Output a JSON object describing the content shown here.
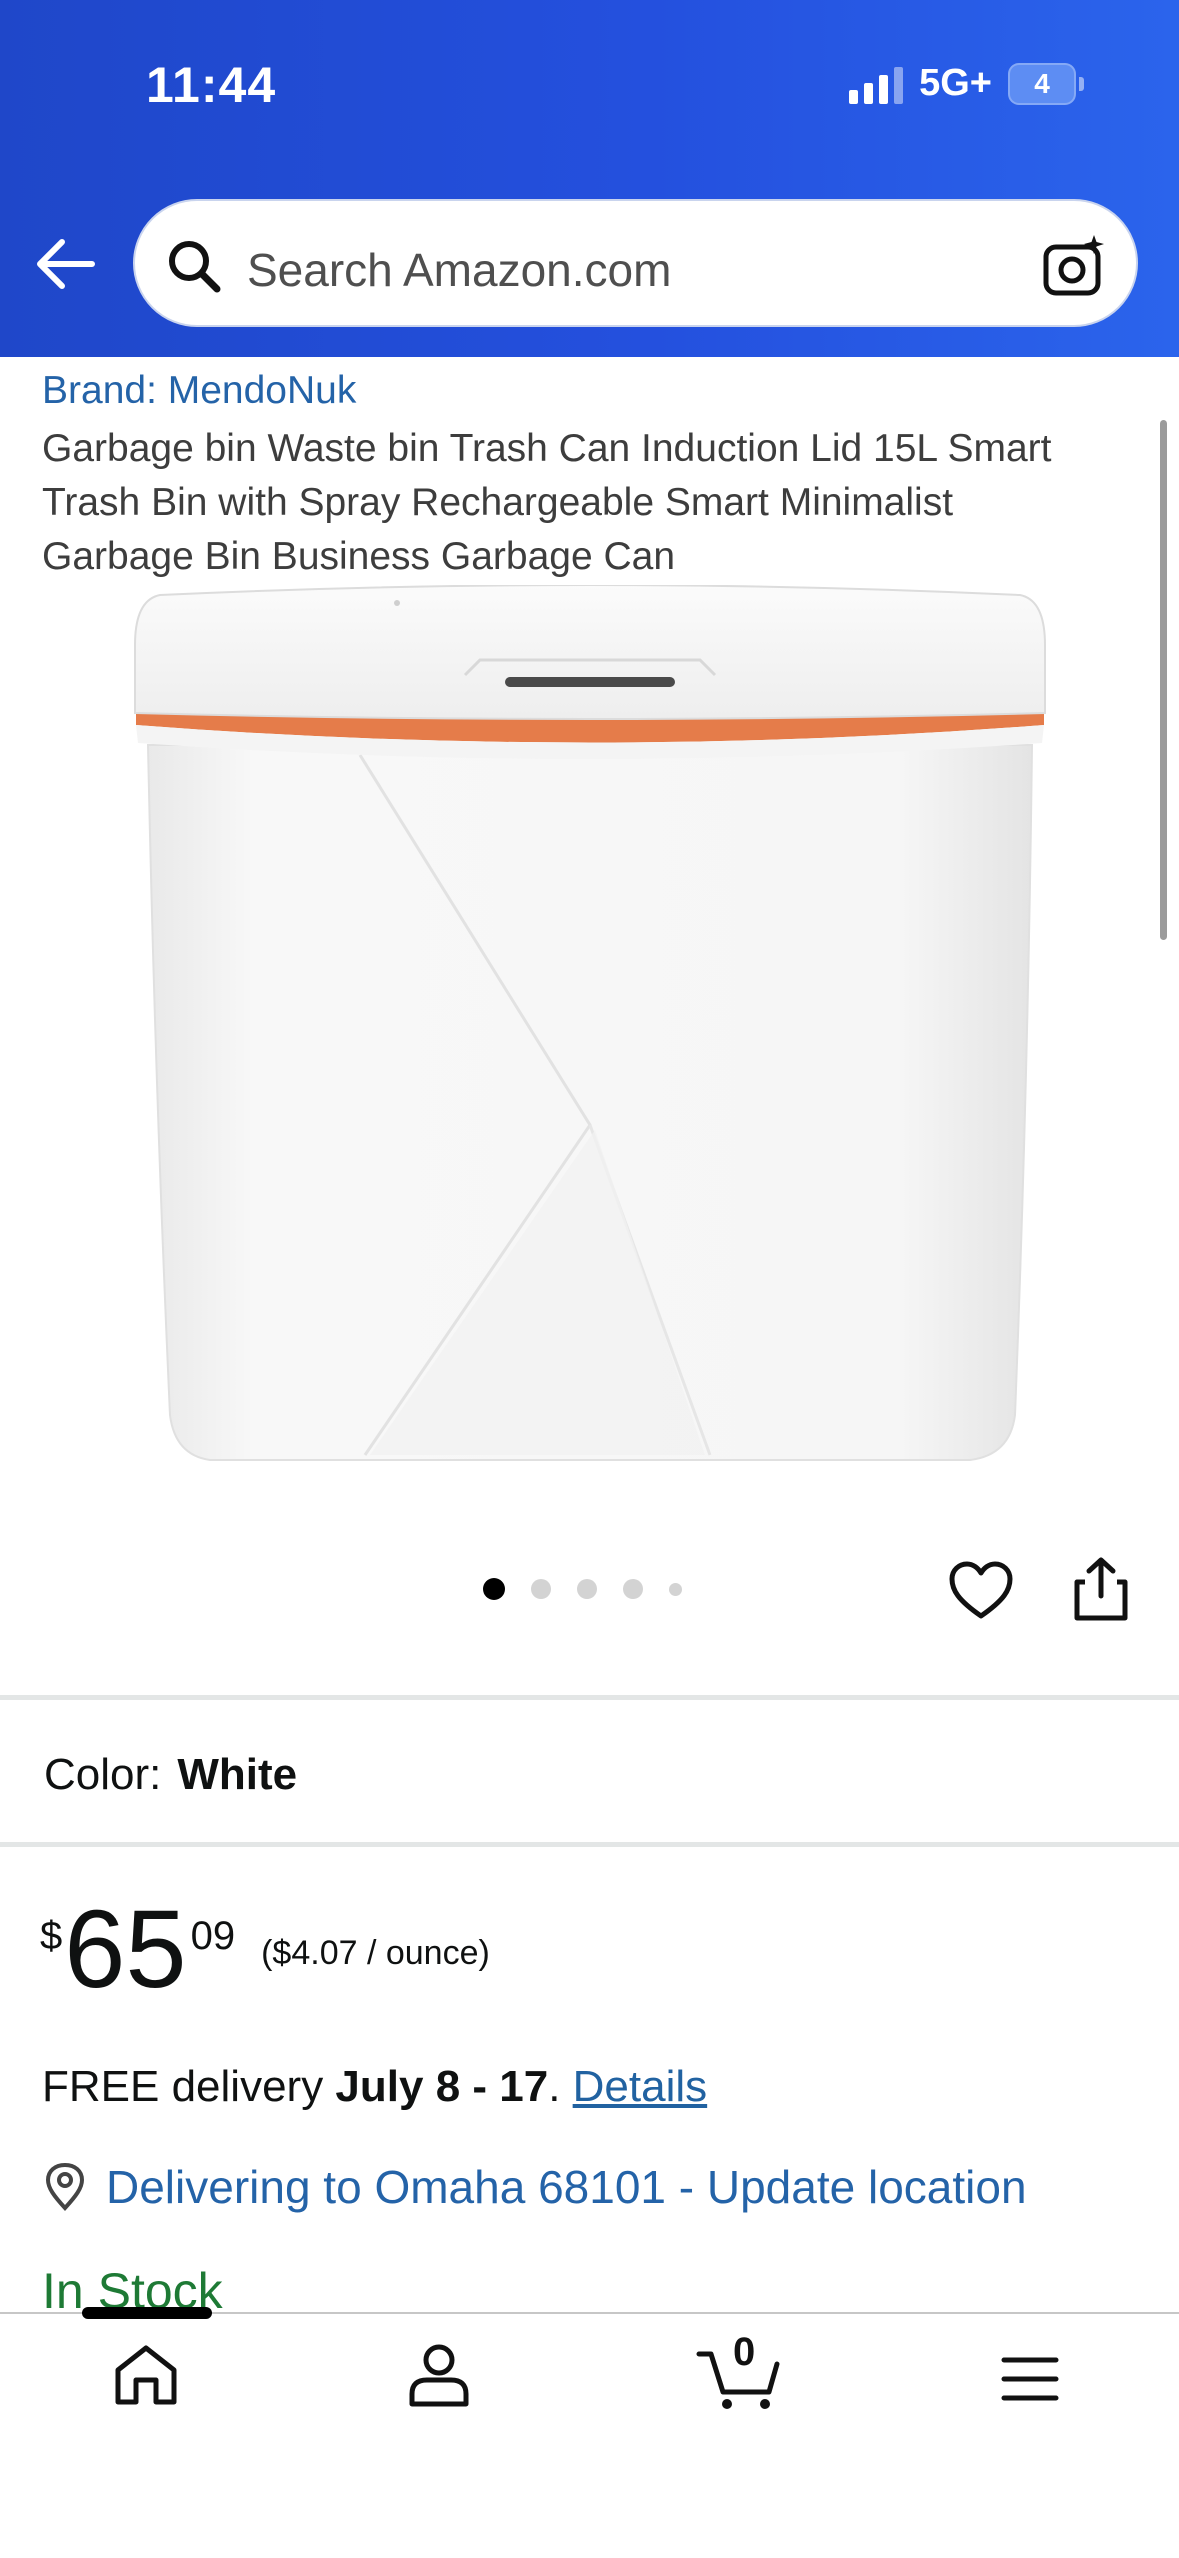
{
  "status_bar": {
    "time": "11:44",
    "network": "5G+",
    "battery": "4"
  },
  "search": {
    "placeholder": "Search Amazon.com"
  },
  "product": {
    "brand": "Brand: MendoNuk",
    "title": "Garbage bin Waste bin Trash Can Induction Lid 15L Smart Trash Bin with Spray Rechargeable Smart Minimalist Garbage Bin Business Garbage Can",
    "image_count": 5,
    "selected_image": 1
  },
  "color": {
    "label": "Color:",
    "value": "White"
  },
  "price": {
    "symbol": "$",
    "whole": "65",
    "fraction": "09",
    "unit_price": "($4.07 / ounce)"
  },
  "delivery": {
    "prefix": "FREE delivery ",
    "dates": "July 8 - 17",
    "suffix": ". ",
    "details_link": "Details"
  },
  "location": {
    "text": "Delivering to Omaha 68101 - Update location"
  },
  "availability": "In Stock",
  "tabbar": {
    "cart_count": "0"
  },
  "colors": {
    "header": "#2450de",
    "link": "#2463a8",
    "stock": "#1e7a35",
    "accent_stripe": "#e57c4a"
  }
}
